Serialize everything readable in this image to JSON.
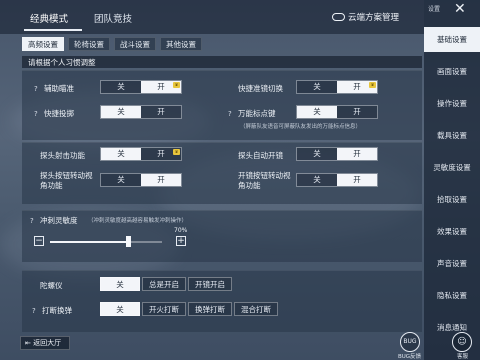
{
  "top_tabs": [
    "经典模式",
    "团队竞技"
  ],
  "cloud_manager": "云端方案管理",
  "sub_tabs": [
    "高频设置",
    "轮椅设置",
    "战斗设置",
    "其他设置"
  ],
  "section_title": "请根据个人习惯调整",
  "rows": {
    "aim_assist": {
      "label": "辅助瞄准",
      "off": "关",
      "on": "开",
      "selected": "on"
    },
    "quick_scope_switch": {
      "label": "快捷准镜切换",
      "off": "关",
      "on": "开",
      "selected": "on"
    },
    "quick_throw": {
      "label": "快捷投掷",
      "off": "关",
      "on": "开",
      "selected": "off"
    },
    "universal_mark": {
      "label": "万能标点键",
      "off": "关",
      "on": "开",
      "selected": "off"
    },
    "universal_mark_note": "（屏蔽队友语音可屏蔽队友发出的万能标点信息）",
    "peek_fire": {
      "label": "探头射击功能",
      "off": "关",
      "on": "开",
      "selected": "off"
    },
    "peek_auto_scope": {
      "label": "探头自动开镜",
      "off": "关",
      "on": "开",
      "selected": "on"
    },
    "peek_button_view": {
      "label": "探头按钮转动视角功能",
      "off": "关",
      "on": "开",
      "selected": "on"
    },
    "scope_button_view": {
      "label": "开镜按钮转动视角功能",
      "off": "关",
      "on": "开",
      "selected": "on"
    }
  },
  "sprint_sensitivity": {
    "label": "冲刺灵敏度",
    "note": "（冲刺灵敏度越高越容易触发冲刺操作）",
    "value_text": "70%",
    "value": 0.7,
    "minus": "−",
    "plus": "+"
  },
  "gyroscope": {
    "label": "陀螺仪",
    "options": [
      "关",
      "总是开启",
      "开镜开启"
    ],
    "selected": 0
  },
  "fire_switch": {
    "label": "打断换弹",
    "options": [
      "关",
      "开火打断",
      "换弹打断",
      "混合打断"
    ],
    "selected": 0
  },
  "sidebar": {
    "top_label": "设置",
    "close": "✕",
    "items": [
      "基础设置",
      "画面设置",
      "操作设置",
      "载具设置",
      "灵敏度设置",
      "拾取设置",
      "效果设置",
      "声音设置",
      "隐私设置",
      "消息通知"
    ],
    "active_index": 0
  },
  "bottom": {
    "back_label": "返回大厅",
    "bug_icon_text": "BUG",
    "bug_label": "BUG反馈",
    "service_label": "客服"
  },
  "colors": {
    "accent_selected": "#f3f5f9",
    "badge": "#e8c63c"
  }
}
